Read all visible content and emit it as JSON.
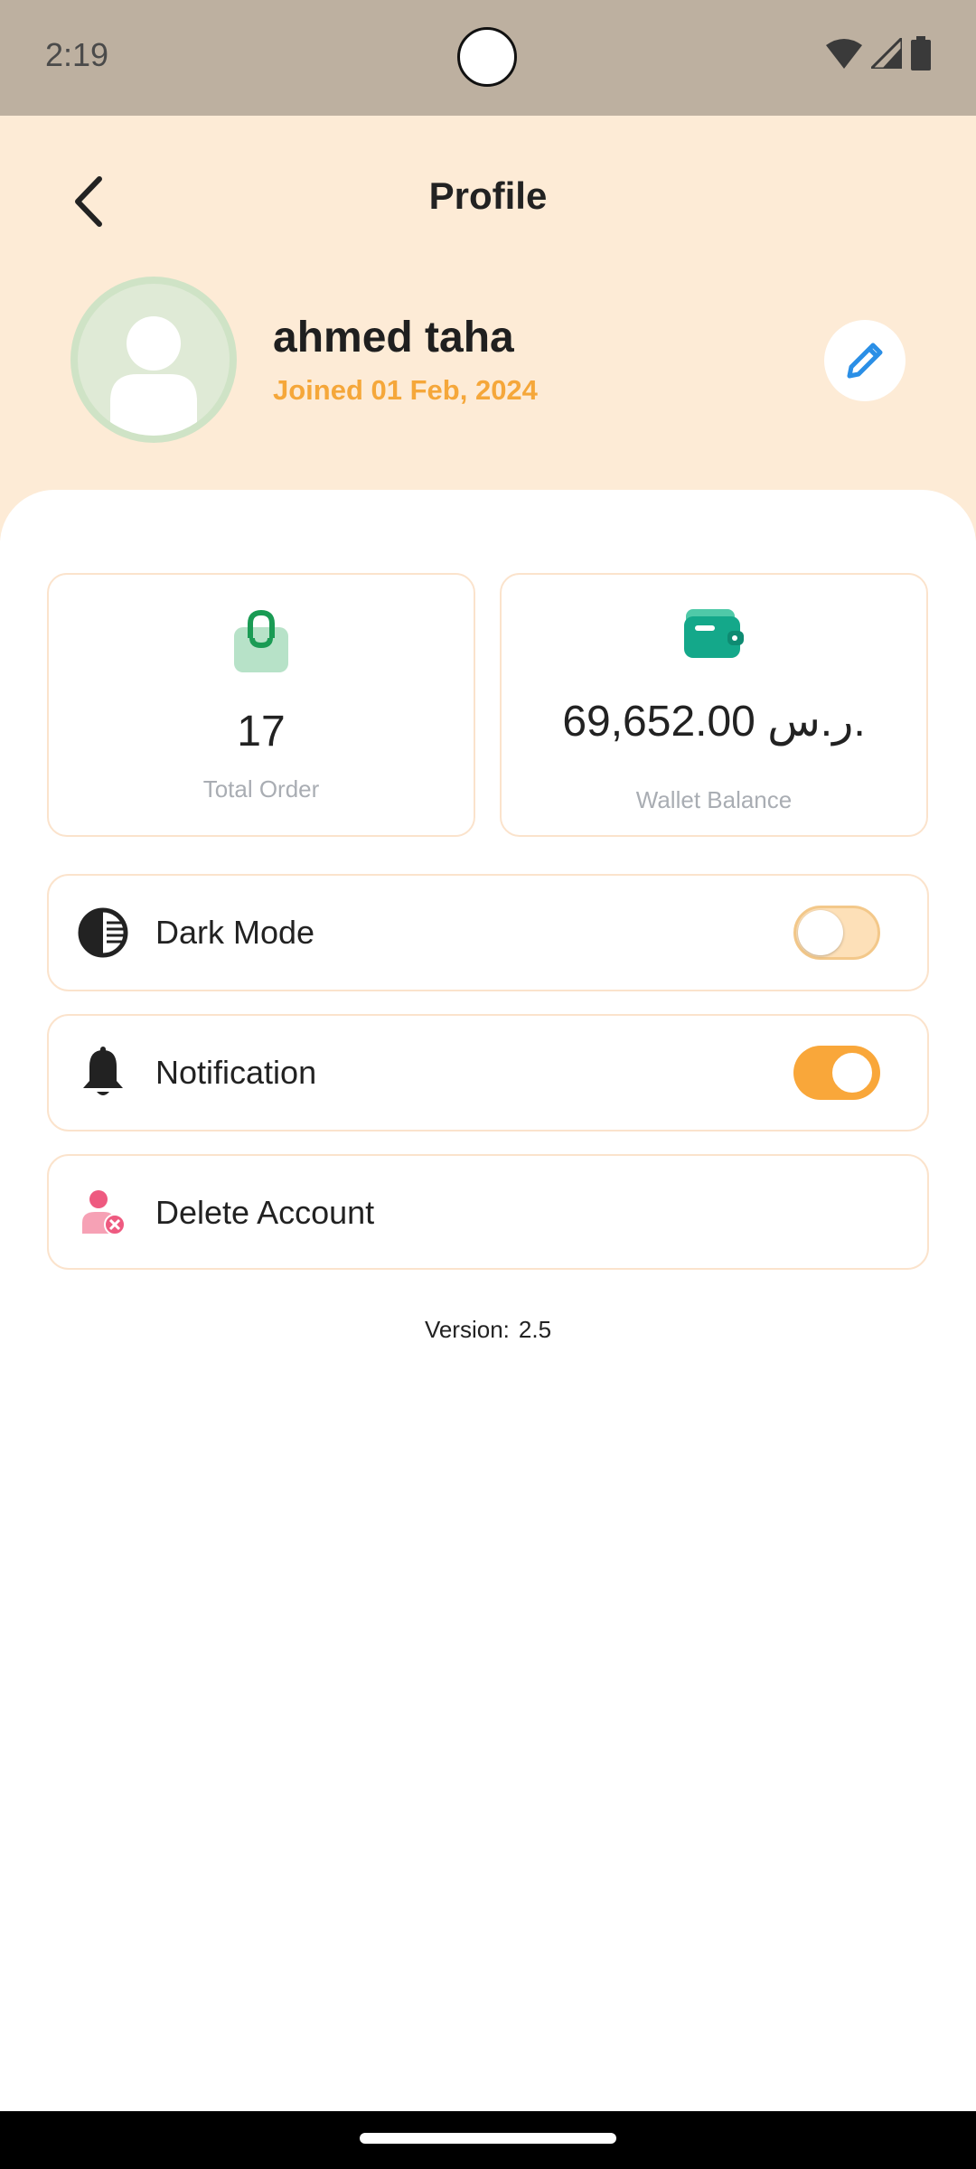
{
  "status_bar": {
    "time": "2:19"
  },
  "header": {
    "title": "Profile",
    "user_name": "ahmed taha",
    "join_date": "Joined 01 Feb, 2024"
  },
  "stats": {
    "orders": {
      "value": "17",
      "label": "Total Order"
    },
    "wallet": {
      "value": "69,652.00 ر.س.",
      "label": "Wallet Balance"
    }
  },
  "settings": {
    "dark_mode": {
      "label": "Dark Mode",
      "enabled": false
    },
    "notification": {
      "label": "Notification",
      "enabled": true
    },
    "delete_account": {
      "label": "Delete Account"
    }
  },
  "footer": {
    "version_label": "Version:",
    "version_value": "2.5"
  },
  "colors": {
    "header_bg": "#fdebd6",
    "accent": "#f9a73a",
    "edit_blue": "#2b8fe6",
    "order_green": "#1a9b54",
    "wallet_teal": "#14a88a",
    "delete_pink": "#ef6f8f"
  }
}
